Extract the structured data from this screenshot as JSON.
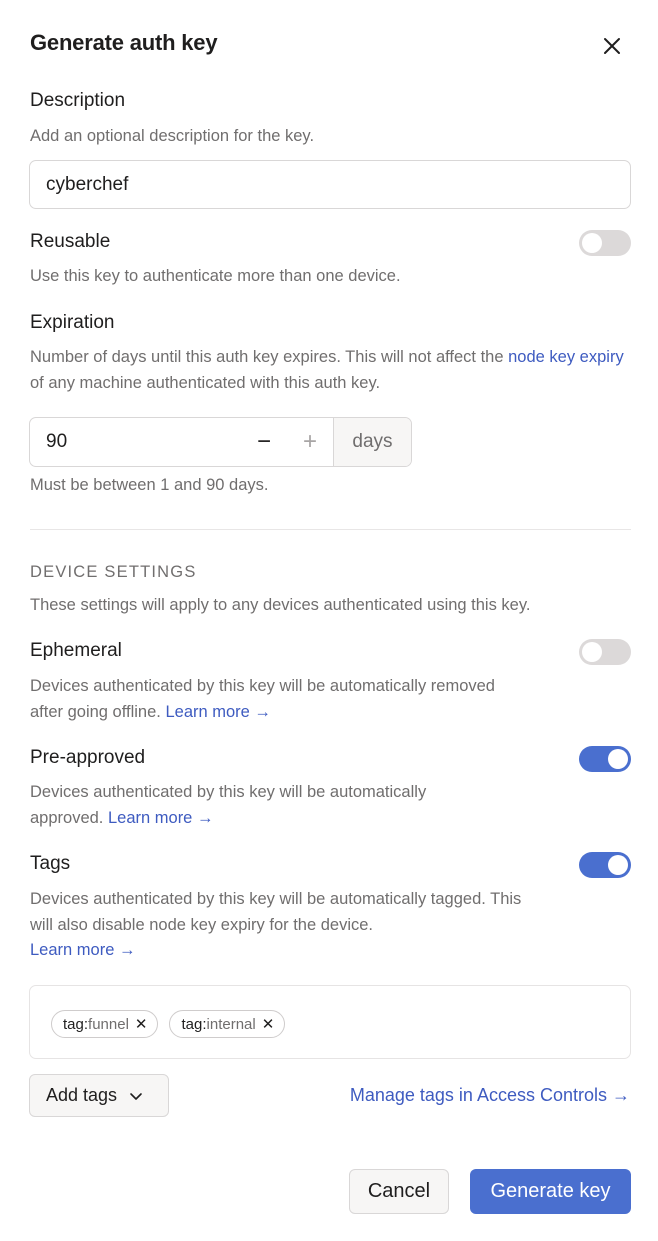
{
  "dialog": {
    "title": "Generate auth key"
  },
  "description": {
    "label": "Description",
    "help": "Add an optional description for the key.",
    "value": "cyberchef"
  },
  "reusable": {
    "label": "Reusable",
    "help": "Use this key to authenticate more than one device.",
    "enabled": false
  },
  "expiration": {
    "label": "Expiration",
    "help_prefix": "Number of days until this auth key expires. This will not affect the ",
    "help_link": "node key expiry",
    "help_suffix": " of any machine authenticated with this auth key.",
    "value": "90",
    "decrement": "−",
    "increment": "+",
    "unit": "days",
    "hint": "Must be between 1 and 90 days."
  },
  "device_settings": {
    "heading": "DEVICE SETTINGS",
    "help": "These settings will apply to any devices authenticated using this key.",
    "ephemeral": {
      "label": "Ephemeral",
      "help": "Devices authenticated by this key will be automatically removed after going offline. ",
      "link": "Learn more →",
      "enabled": false
    },
    "preapproved": {
      "label": "Pre-approved",
      "help": "Devices authenticated by this key will be automatically approved. ",
      "link": "Learn more →",
      "enabled": true
    },
    "tags": {
      "label": "Tags",
      "help": "Devices authenticated by this key will be automatically tagged. This will also disable node key expiry for the device.",
      "link": "Learn more →",
      "enabled": true,
      "items": [
        {
          "prefix": "tag:",
          "name": "funnel"
        },
        {
          "prefix": "tag:",
          "name": "internal"
        }
      ],
      "add_label": "Add tags",
      "manage_link": "Manage tags in Access Controls →"
    }
  },
  "footer": {
    "cancel": "Cancel",
    "generate": "Generate key"
  },
  "colors": {
    "accent": "#4a6fcf",
    "link": "#3e5bc0",
    "toggle_off": "#dcd9d9"
  }
}
